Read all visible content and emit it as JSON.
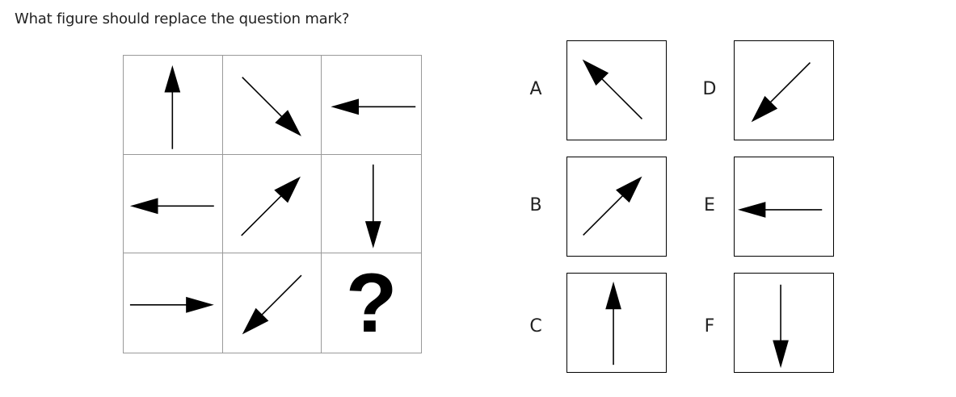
{
  "question": "What figure should replace the question mark?",
  "matrix": {
    "cells": [
      {
        "arrow": "up-arrow-icon"
      },
      {
        "arrow": "down-right-arrow-icon"
      },
      {
        "arrow": "left-arrow-icon"
      },
      {
        "arrow": "left-arrow-icon"
      },
      {
        "arrow": "up-right-arrow-icon"
      },
      {
        "arrow": "down-arrow-icon"
      },
      {
        "arrow": "right-arrow-icon"
      },
      {
        "arrow": "down-left-arrow-icon"
      },
      {
        "symbol": "?"
      }
    ]
  },
  "options": [
    {
      "label": "A",
      "arrow": "up-left-arrow-icon"
    },
    {
      "label": "B",
      "arrow": "up-right-arrow-icon"
    },
    {
      "label": "C",
      "arrow": "up-arrow-icon"
    },
    {
      "label": "D",
      "arrow": "down-left-arrow-icon"
    },
    {
      "label": "E",
      "arrow": "left-arrow-icon"
    },
    {
      "label": "F",
      "arrow": "down-arrow-icon"
    }
  ],
  "colors": {
    "arrow": "#000000",
    "grid_line": "#999999",
    "text": "#222222"
  }
}
